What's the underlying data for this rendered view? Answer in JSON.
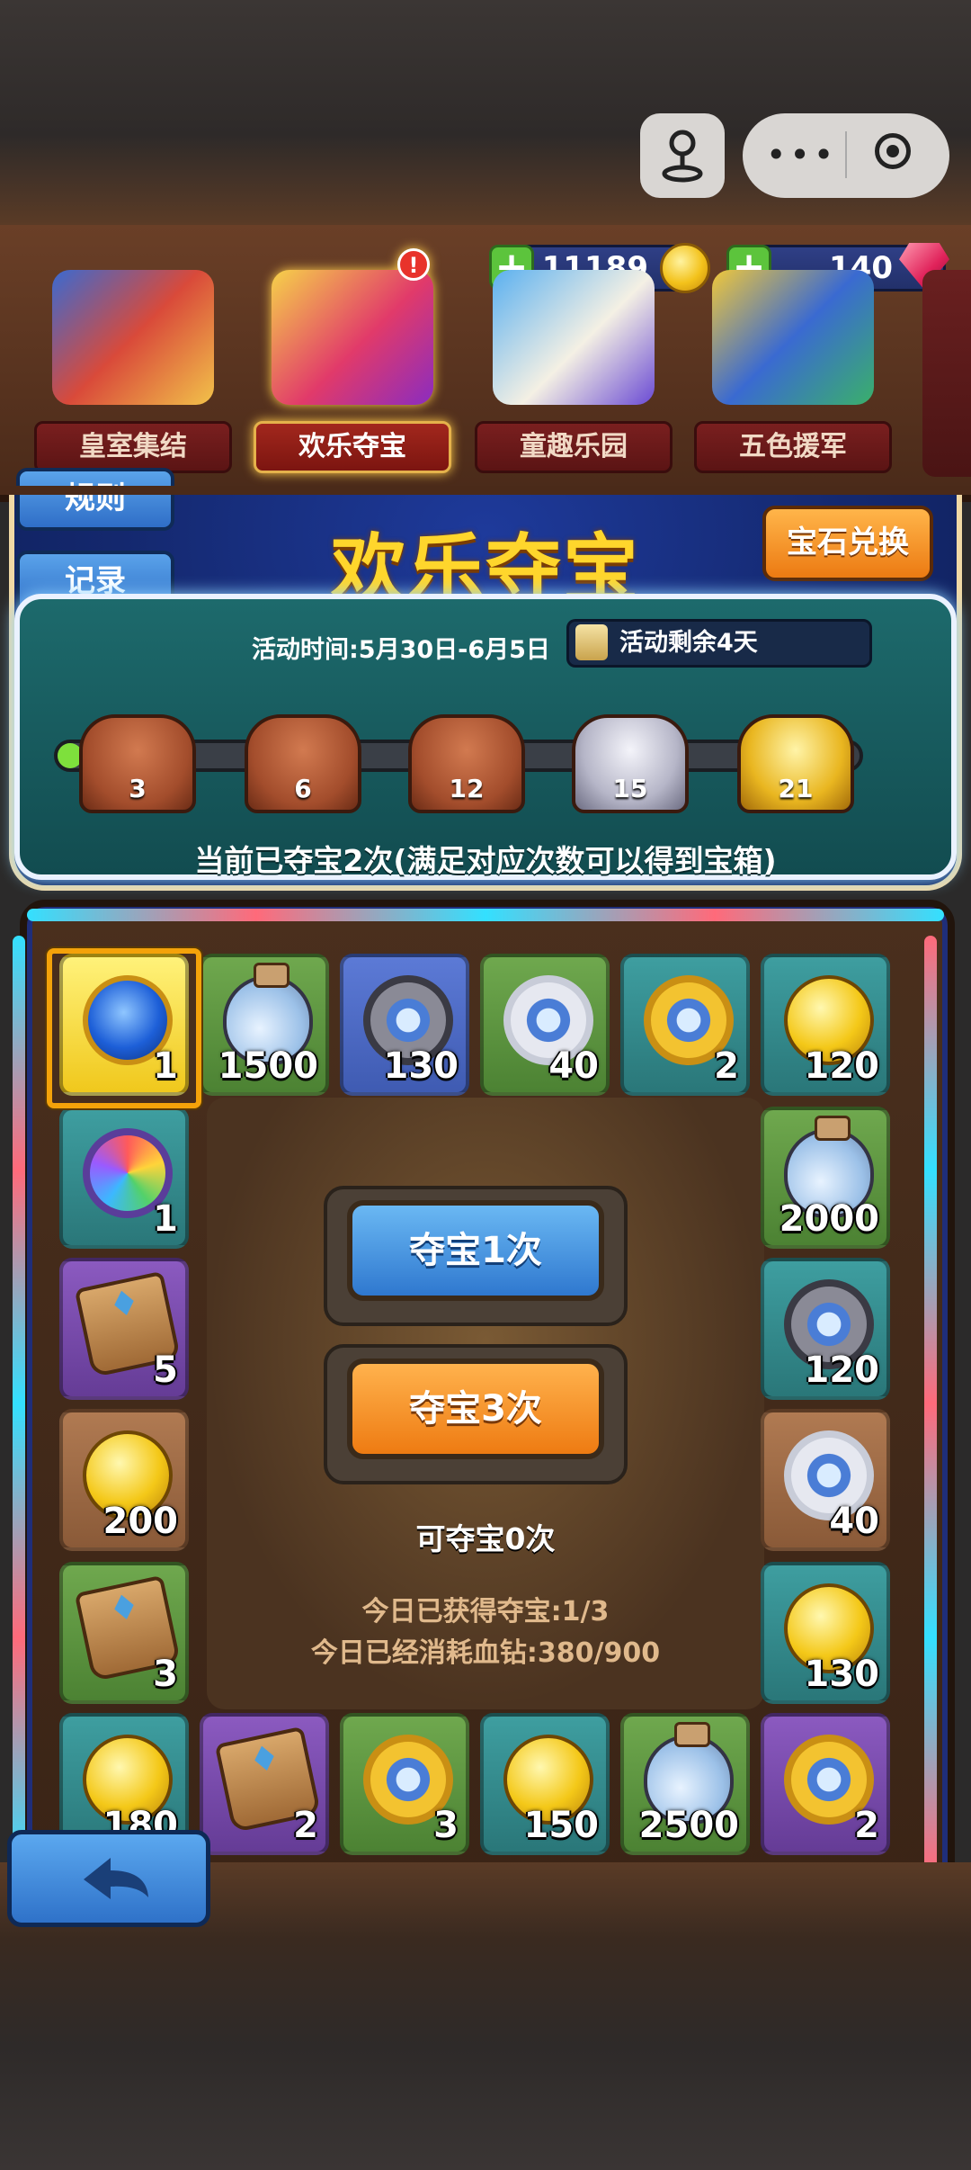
{
  "header": {
    "coins": "11189",
    "gems": "140"
  },
  "tabs": [
    {
      "label": "皇室集结"
    },
    {
      "label": "欢乐夺宝",
      "badge": "!"
    },
    {
      "label": "童趣乐园"
    },
    {
      "label": "五色援军"
    }
  ],
  "event": {
    "rules_label": "规则",
    "records_label": "记录",
    "title": "欢乐夺宝",
    "exchange_label": "宝石兑换",
    "time_text": "活动时间:5月30日-6月5日",
    "remaining_text": "活动剩余4天",
    "progress_fraction": 0.02,
    "milestones": [
      "3",
      "6",
      "12",
      "15",
      "21"
    ],
    "status_text": "当前已夺宝2次(满足对应次数可以得到宝箱)"
  },
  "board": {
    "top_row": [
      {
        "icon": "blue-rune-medal-icon",
        "count": "1"
      },
      {
        "icon": "potion-bottle-icon",
        "count": "1500"
      },
      {
        "icon": "dark-gem-medal-icon",
        "count": "130"
      },
      {
        "icon": "silver-gem-medal-icon",
        "count": "40"
      },
      {
        "icon": "gold-gem-medal-icon",
        "count": "2"
      },
      {
        "icon": "gold-coin-icon",
        "count": "120"
      }
    ],
    "left_col": [
      {
        "icon": "rainbow-gem-medal-icon",
        "count": "1"
      },
      {
        "icon": "scroll-pouch-icon",
        "count": "5"
      },
      {
        "icon": "gold-coin-icon",
        "count": "200"
      },
      {
        "icon": "scroll-pouch-icon",
        "count": "3"
      }
    ],
    "right_col": [
      {
        "icon": "potion-bottle-icon",
        "count": "2000"
      },
      {
        "icon": "dark-gem-medal-icon",
        "count": "120"
      },
      {
        "icon": "silver-gem-medal-icon",
        "count": "40"
      },
      {
        "icon": "gold-coin-icon",
        "count": "130"
      }
    ],
    "bottom_row": [
      {
        "icon": "gold-coin-icon",
        "count": "180"
      },
      {
        "icon": "scroll-pouch-icon",
        "count": "2"
      },
      {
        "icon": "gold-gem-medal-icon",
        "count": "3"
      },
      {
        "icon": "gold-coin-icon",
        "count": "150"
      },
      {
        "icon": "potion-bottle-icon",
        "count": "2500"
      },
      {
        "icon": "gold-gem-medal-icon",
        "count": "2"
      }
    ],
    "draw_once_label": "夺宝1次",
    "draw_thrice_label": "夺宝3次",
    "draws_left": "可夺宝0次",
    "today_obtained": "今日已获得夺宝:1/3",
    "today_spent": "今日已经消耗血钻:380/900"
  },
  "colors": {
    "title_gold": "#ffd62c",
    "blue_button": "#2f78cf",
    "orange_button": "#ee7b12"
  }
}
